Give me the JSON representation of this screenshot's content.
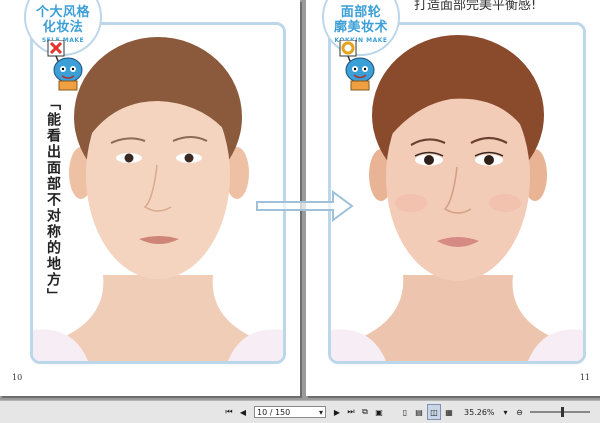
{
  "left_page": {
    "badge_title_line1": "个大风格",
    "badge_title_line2": "化妆法",
    "badge_sub": "SELF MAKE",
    "vertical_caption": "「能看出面部不对称的地方」",
    "page_number": "10"
  },
  "right_page": {
    "badge_title_line1": "面部轮",
    "badge_title_line2": "廓美妆术",
    "badge_sub": "KOKKIN MAKE",
    "top_text": "打造面部完美平衡感!",
    "page_number": "11"
  },
  "toolbar": {
    "page_field_value": "10 / 150",
    "zoom_value": "35.26%",
    "zoom_fraction": 0.55
  },
  "colors": {
    "accent_blue": "#3c9fd6",
    "frame_blue": "#bcd6ea",
    "mark_red": "#e0332b"
  }
}
